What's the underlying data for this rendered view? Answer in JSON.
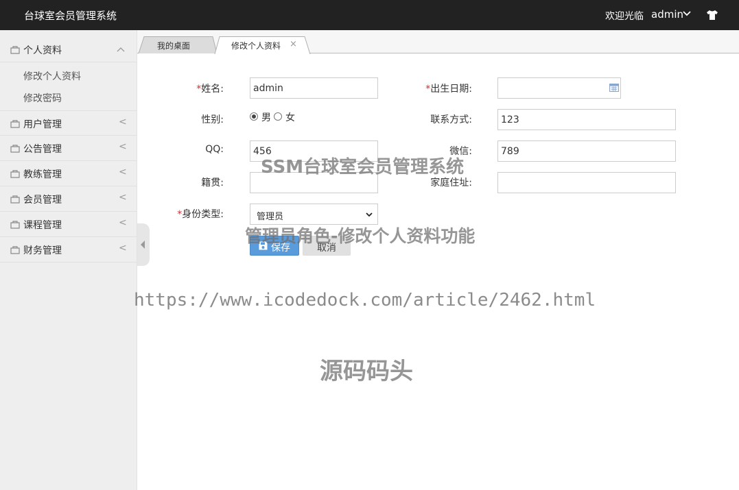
{
  "header": {
    "title": "台球室会员管理系统",
    "welcome": "欢迎光临",
    "user": "admin"
  },
  "sidebar": {
    "items": [
      {
        "label": "个人资料",
        "arrow": "^"
      },
      {
        "label": "用户管理",
        "arrow": "<"
      },
      {
        "label": "公告管理",
        "arrow": "<"
      },
      {
        "label": "教练管理",
        "arrow": "<"
      },
      {
        "label": "会员管理",
        "arrow": "<"
      },
      {
        "label": "课程管理",
        "arrow": "<"
      },
      {
        "label": "财务管理",
        "arrow": "<"
      }
    ],
    "subitems": [
      "修改个人资料",
      "修改密码"
    ]
  },
  "tabs": [
    {
      "label": "我的桌面"
    },
    {
      "label": "修改个人资料",
      "close": "×"
    }
  ],
  "form": {
    "required_mark": "*",
    "name_label": "姓名:",
    "name_value": "admin",
    "birth_label": "出生日期:",
    "birth_value": "",
    "gender_label": "性别:",
    "gender_male": "男",
    "gender_female": "女",
    "gender_selected": "男",
    "contact_label": "联系方式:",
    "contact_value": "123",
    "qq_label": "QQ:",
    "qq_value": "456",
    "wechat_label": "微信:",
    "wechat_value": "789",
    "origin_label": "籍贯:",
    "origin_value": "",
    "address_label": "家庭住址:",
    "address_value": "",
    "role_label": "身份类型:",
    "role_value": "管理员",
    "save_label": "保存",
    "cancel_label": "取消"
  },
  "watermarks": {
    "line1": "SSM台球室会员管理系统",
    "line2": "管理员角色-修改个人资料功能",
    "url": "https://www.icodedock.com/article/2462.html",
    "brand": "源码码头"
  },
  "colors": {
    "topbar": "#222222",
    "sidebar": "#eeeeee",
    "primary_button": "#5a9bdc",
    "required": "#ee2222"
  }
}
